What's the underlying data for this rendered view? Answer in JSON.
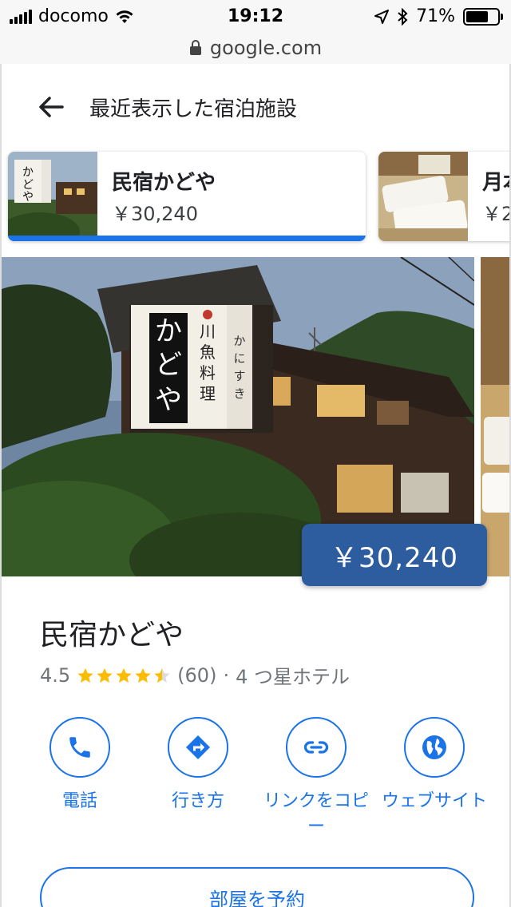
{
  "status_bar": {
    "carrier": "docomo",
    "time": "19:12",
    "battery": "71%"
  },
  "url_bar": {
    "domain": "google.com"
  },
  "header": {
    "title": "最近表示した宿泊施設"
  },
  "recent": [
    {
      "name": "民宿かどや",
      "price": "￥30,240"
    },
    {
      "name": "月本",
      "price": "￥2"
    }
  ],
  "hotel": {
    "name": "民宿かどや",
    "rating": "4.5",
    "rating_value": 4.5,
    "reviews": "(60)",
    "separator": "·",
    "category": "4 つ星ホテル",
    "price_badge": "￥30,240"
  },
  "sign": {
    "vertical_text": "かどや",
    "side_text": "川魚料理",
    "side2": "かにすき"
  },
  "actions": [
    {
      "label": "電話",
      "icon": "phone-icon"
    },
    {
      "label": "行き方",
      "icon": "directions-icon"
    },
    {
      "label": "リンクをコピー",
      "icon": "link-icon"
    },
    {
      "label": "ウェブサイト",
      "icon": "globe-icon"
    }
  ],
  "book_button": "部屋を予約",
  "colors": {
    "accent": "#1a73e8",
    "badge": "#2d5d9f",
    "star": "#fbbc04"
  }
}
